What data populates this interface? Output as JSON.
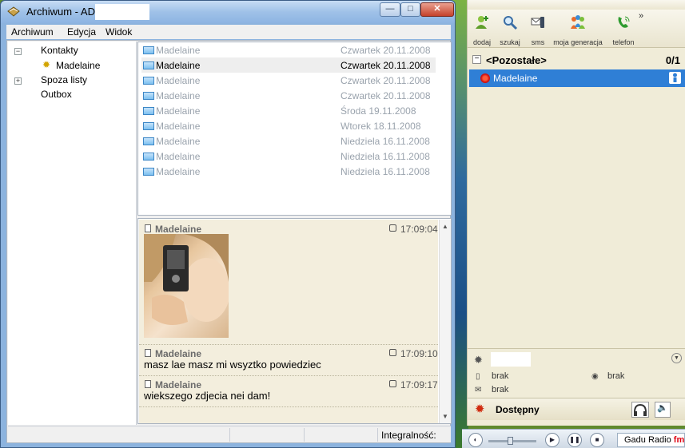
{
  "archive": {
    "title": "Archiwum - ADI",
    "menu": [
      "Archiwum",
      "Edycja",
      "Widok"
    ],
    "tree": {
      "contacts": "Kontakty",
      "contact_name": "Madelaine",
      "outside": "Spoza listy",
      "outbox": "Outbox"
    },
    "messages": [
      {
        "name": "Madelaine",
        "date": "Czwartek 20.11.2008",
        "selected": false
      },
      {
        "name": "Madelaine",
        "date": "Czwartek 20.11.2008",
        "selected": true
      },
      {
        "name": "Madelaine",
        "date": "Czwartek 20.11.2008",
        "selected": false
      },
      {
        "name": "Madelaine",
        "date": "Czwartek 20.11.2008",
        "selected": false
      },
      {
        "name": "Madelaine",
        "date": "Środa 19.11.2008",
        "selected": false
      },
      {
        "name": "Madelaine",
        "date": "Wtorek 18.11.2008",
        "selected": false
      },
      {
        "name": "Madelaine",
        "date": "Niedziela 16.11.2008",
        "selected": false
      },
      {
        "name": "Madelaine",
        "date": "Niedziela 16.11.2008",
        "selected": false
      },
      {
        "name": "Madelaine",
        "date": "Niedziela 16.11.2008",
        "selected": false
      }
    ],
    "chat": [
      {
        "sender": "Madelaine",
        "time": "17:09:04",
        "text": ""
      },
      {
        "sender": "Madelaine",
        "time": "17:09:10",
        "text": "masz lae masz mi wsyztko powiedziec"
      },
      {
        "sender": "Madelaine",
        "time": "17:09:17",
        "text": "wiekszego zdjecia nei dam!"
      }
    ],
    "status": "Integralność:"
  },
  "gg": {
    "toolbar": [
      "dodaj",
      "szukaj",
      "sms",
      "moja generacja",
      "telefon"
    ],
    "more": "»",
    "group": {
      "name": "<Pozostałe>",
      "count": "0/1"
    },
    "contact": "Madelaine",
    "info": {
      "field1": "brak",
      "field2": "brak",
      "field3": "brak"
    },
    "status": "Dostępny"
  },
  "radio": {
    "label": "Gadu Radio",
    "suffix": "fm"
  }
}
